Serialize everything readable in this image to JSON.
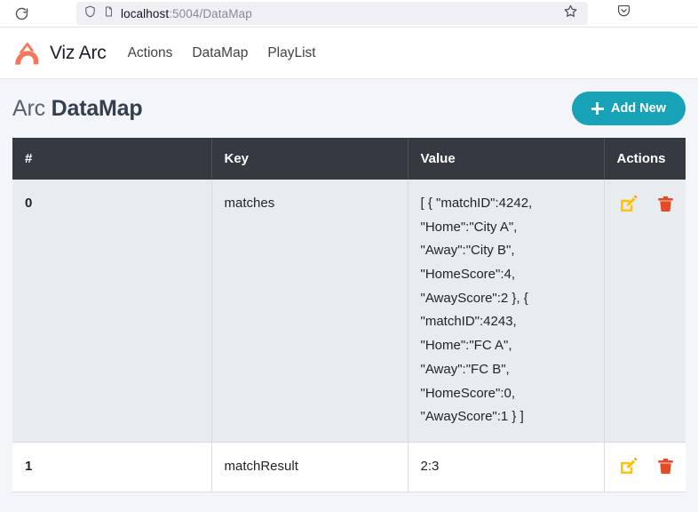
{
  "browser": {
    "reload_icon": "reload-icon",
    "shield_icon": "shield-icon",
    "page_icon": "page-document-icon",
    "url_host": "localhost",
    "url_rest": ":5004/DataMap",
    "bookmark_icon": "star-bookmark-icon",
    "pocket_icon": "pocket-save-icon"
  },
  "nav": {
    "logo_icon": "viz-arc-logo-icon",
    "brand": "Viz Arc",
    "links": [
      {
        "label": "Actions"
      },
      {
        "label": "DataMap"
      },
      {
        "label": "PlayList"
      }
    ]
  },
  "page": {
    "title_light": "Arc",
    "title_bold": "DataMap",
    "add_button": {
      "label": "Add New",
      "icon": "plus-icon",
      "color": "#17a2b8"
    }
  },
  "table": {
    "columns": [
      "#",
      "Key",
      "Value",
      "Actions"
    ],
    "rows": [
      {
        "index": "0",
        "key": "matches",
        "value": "[ { \"matchID\":4242,\n\"Home\":\"City A\",\n\"Away\":\"City B\",\n\"HomeScore\":4,\n\"AwayScore\":2 }, {\n\"matchID\":4243,\n\"Home\":\"FC A\",\n\"Away\":\"FC B\",\n\"HomeScore\":0,\n\"AwayScore\":1 } ]",
        "edit_icon": "edit-pencil-icon",
        "delete_icon": "trash-delete-icon"
      },
      {
        "index": "1",
        "key": "matchResult",
        "value": "2:3",
        "edit_icon": "edit-pencil-icon",
        "delete_icon": "trash-delete-icon"
      }
    ]
  },
  "colors": {
    "accent_teal": "#17a2b8",
    "header_dark": "#343a40",
    "logo_orange": "#f5775a",
    "edit_yellow": "#ffc107",
    "delete_red": "#e34b27",
    "page_bg": "#f4f5f9",
    "row_stripe": "#e9ecef"
  }
}
